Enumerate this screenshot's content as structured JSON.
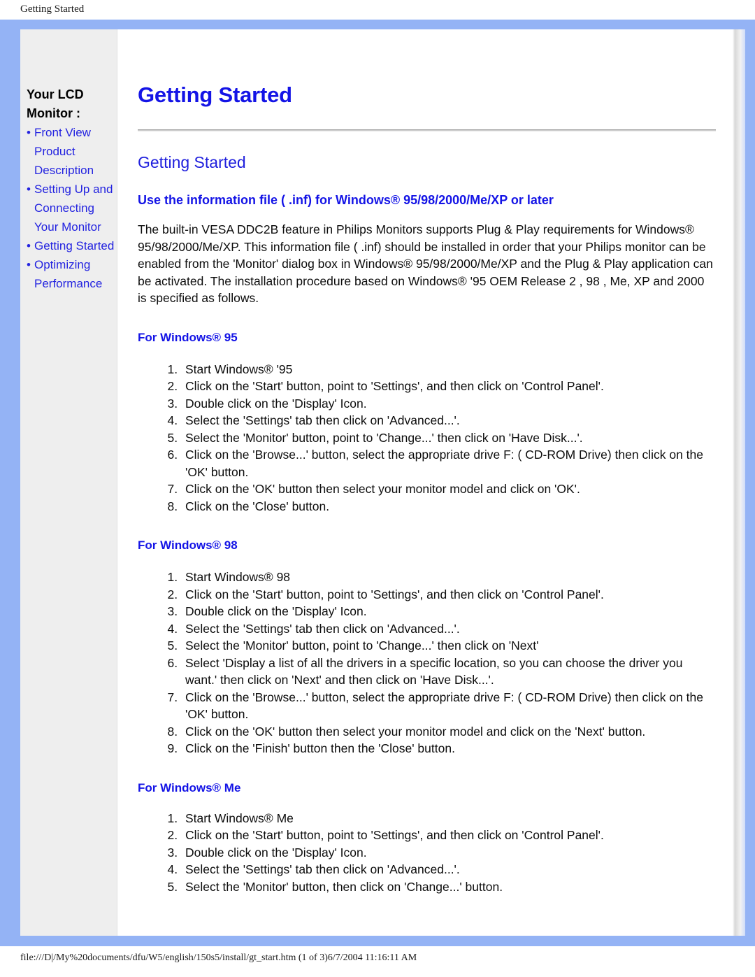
{
  "browser": {
    "header_title": "Getting Started",
    "footer_path": "file:///D|/My%20documents/dfu/W5/english/150s5/install/gt_start.htm (1 of 3)6/7/2004 11:16:11 AM"
  },
  "colors": {
    "frame_blue": "#94b3f5",
    "sidebar_bg": "#eeeeee",
    "link_blue": "#2323e0",
    "heading_blue": "#1414e6",
    "body_text": "#0d0d0d"
  },
  "sidebar": {
    "title": "Your LCD Monitor :",
    "items": [
      {
        "label": "Front View Product Description"
      },
      {
        "label": "Setting Up and Connecting Your Monitor"
      },
      {
        "label": "Getting Started"
      },
      {
        "label": "Optimizing Performance"
      }
    ]
  },
  "main": {
    "doc_title": "Getting Started",
    "section_title": "Getting Started",
    "subsection_title": "Use the information file ( .inf) for Windows® 95/98/2000/Me/XP or later",
    "intro_paragraph": "The built-in VESA DDC2B feature in Philips Monitors supports Plug & Play requirements for Windows® 95/98/2000/Me/XP. This information file ( .inf) should be installed in order that your Philips monitor can be enabled from the 'Monitor' dialog box in Windows® 95/98/2000/Me/XP and the Plug & Play application can be activated. The installation procedure based on Windows® '95 OEM Release 2 , 98 , Me, XP and 2000 is specified as follows.",
    "sections": [
      {
        "heading": "For Windows® 95",
        "steps": [
          "Start Windows® '95",
          "Click on the 'Start' button, point to 'Settings', and then click on 'Control Panel'.",
          "Double click on the 'Display' Icon.",
          "Select the 'Settings' tab then click on 'Advanced...'.",
          "Select the 'Monitor' button, point to 'Change...' then click on 'Have Disk...'.",
          "Click on the 'Browse...' button, select the appropriate drive F: ( CD-ROM Drive) then click on the 'OK' button.",
          "Click on the 'OK' button then select your monitor model and click on 'OK'.",
          "Click on the 'Close' button."
        ]
      },
      {
        "heading": "For Windows® 98",
        "steps": [
          "Start Windows® 98",
          "Click on the 'Start' button, point to 'Settings', and then click on 'Control Panel'.",
          "Double click on the 'Display' Icon.",
          "Select the 'Settings' tab then click on 'Advanced...'.",
          "Select the 'Monitor' button, point to 'Change...' then click on 'Next'",
          "Select 'Display a list of all the drivers in a specific location, so you can choose the driver you want.' then click on 'Next' and then click on 'Have Disk...'.",
          "Click on the 'Browse...' button, select the appropriate drive F: ( CD-ROM Drive) then click on the 'OK' button.",
          "Click on the 'OK' button then select your monitor model and click on the 'Next' button.",
          "Click on the 'Finish' button then the 'Close' button."
        ]
      },
      {
        "heading": "For Windows® Me",
        "steps": [
          "Start Windows® Me",
          "Click on the 'Start' button, point to 'Settings', and then click on 'Control Panel'.",
          "Double click on the 'Display' Icon.",
          "Select the 'Settings' tab then click on 'Advanced...'.",
          "Select the 'Monitor' button, then click on 'Change...' button."
        ]
      }
    ]
  }
}
